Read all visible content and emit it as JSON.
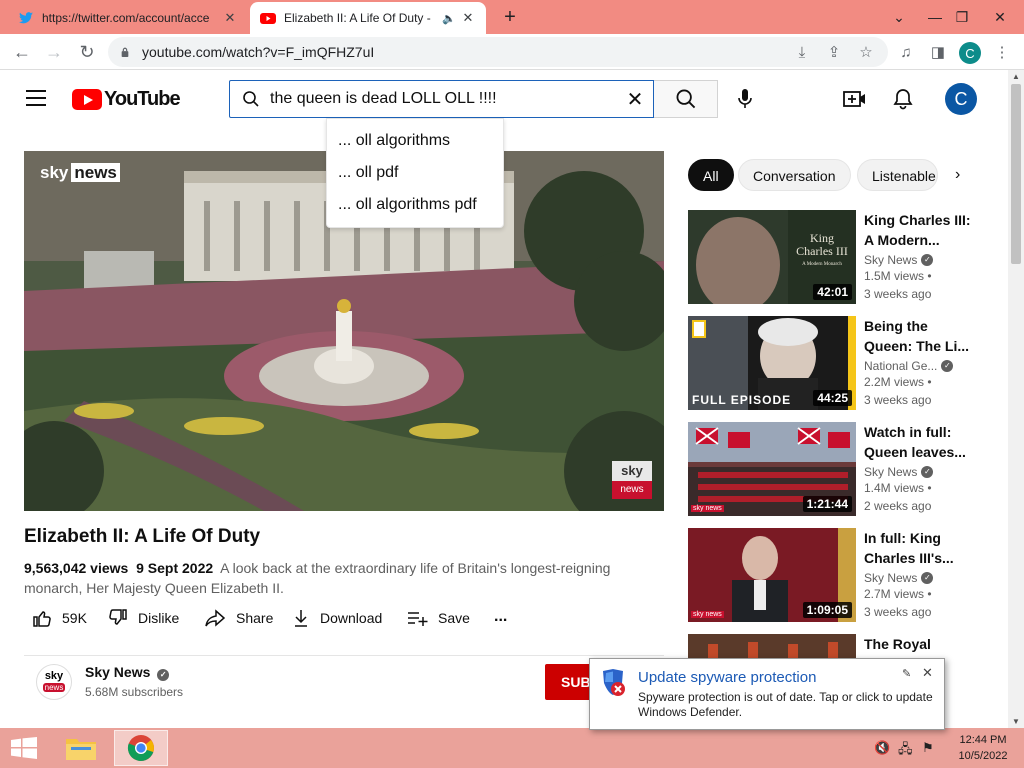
{
  "browser": {
    "tabs": [
      {
        "title": "https://twitter.com/account/acce",
        "favicon": "twitter-bird-icon",
        "active": false
      },
      {
        "title": "Elizabeth II: A Life Of Duty -",
        "favicon": "youtube-icon",
        "active": true
      }
    ],
    "url": "youtube.com/watch?v=F_imQFHZ7uI",
    "profile_initial": "C"
  },
  "youtube": {
    "logo_text": "YouTube",
    "search": {
      "value": "the queen is dead LOLL OLL !!!!",
      "suggestions": [
        "... oll algorithms",
        "... oll pdf",
        "... oll algorithms pdf"
      ]
    },
    "avatar_initial": "C",
    "video": {
      "overlay_brand": "sky",
      "overlay_brand_news": "news",
      "bug_top": "sky",
      "bug_bottom": "news",
      "title": "Elizabeth II: A Life Of Duty",
      "views": "9,563,042 views",
      "date": "9 Sept 2022",
      "description": "A look back at the extraordinary life of Britain's longest-reigning monarch, Her Majesty Queen Elizabeth II."
    },
    "actions": {
      "likes": "59K",
      "dislike": "Dislike",
      "share": "Share",
      "download": "Download",
      "save": "Save",
      "more": "..."
    },
    "channel": {
      "name": "Sky News",
      "subscribers": "5.68M subscribers",
      "subscribe": "SUB",
      "avatar_top": "sky",
      "avatar_bottom": "news"
    },
    "chips": [
      "All",
      "Conversation",
      "Listenable"
    ],
    "recommendations": [
      {
        "title_line1": "King Charles III:",
        "title_line2": "A Modern...",
        "channel": "Sky News",
        "views": "1.5M views •",
        "age": "3 weeks ago",
        "duration": "42:01"
      },
      {
        "title_line1": "Being the",
        "title_line2": "Queen: The Li...",
        "channel": "National Ge...",
        "views": "2.2M views •",
        "age": "3 weeks ago",
        "duration": "44:25",
        "thumb_label": "FULL EPISODE"
      },
      {
        "title_line1": "Watch in full:",
        "title_line2": "Queen leaves...",
        "channel": "Sky News",
        "views": "1.4M views •",
        "age": "2 weeks ago",
        "duration": "1:21:44"
      },
      {
        "title_line1": "In full: King",
        "title_line2": "Charles III's...",
        "channel": "Sky News",
        "views": "2.7M views •",
        "age": "3 weeks ago",
        "duration": "1:09:05"
      },
      {
        "title_line1": "The Royal",
        "title_line2": "",
        "channel": "",
        "views": "",
        "age": "",
        "duration": ""
      }
    ],
    "rec1_thumb_text_a": "King",
    "rec1_thumb_text_b": "Charles III",
    "rec1_thumb_text_c": "A Modern Monarch",
    "skynews_small": "sky news"
  },
  "notification": {
    "title": "Update spyware protection",
    "body": "Spyware protection is out of date. Tap or click to update Windows Defender."
  },
  "taskbar": {
    "time": "12:44 PM",
    "date": "10/5/2022"
  },
  "colors": {
    "tab_strip": "#f28b82",
    "taskbar": "#eaa29a",
    "youtube_red": "#ff0000",
    "search_focus": "#1c62b9",
    "subscribe": "#cc0000"
  }
}
